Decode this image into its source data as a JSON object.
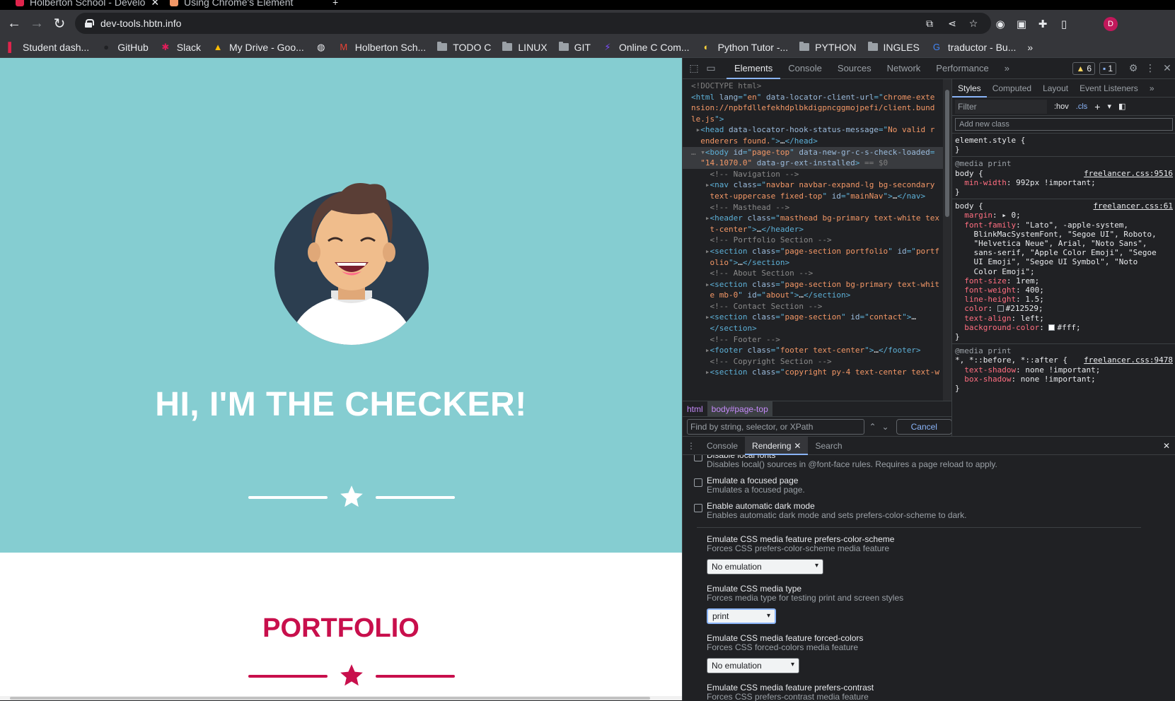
{
  "browser": {
    "tabs": [
      {
        "title": "Holberton School - Develo"
      },
      {
        "title": "Using Chrome's Element"
      }
    ],
    "new_tab": "+",
    "url": "dev-tools.hbtn.info",
    "profile_initial": "D"
  },
  "bookmarks": [
    {
      "label": "Student dash...",
      "icon": "holberton-icon"
    },
    {
      "label": "GitHub",
      "icon": "github-icon"
    },
    {
      "label": "Slack",
      "icon": "slack-icon"
    },
    {
      "label": "My Drive - Goo...",
      "icon": "drive-icon"
    },
    {
      "label": "",
      "icon": "globe-icon"
    },
    {
      "label": "Holberton Sch...",
      "icon": "gmail-icon"
    },
    {
      "label": "TODO C",
      "icon": "folder-icon"
    },
    {
      "label": "LINUX",
      "icon": "folder-icon"
    },
    {
      "label": "GIT",
      "icon": "folder-icon"
    },
    {
      "label": "Online C Com...",
      "icon": "compiler-icon"
    },
    {
      "label": "Python Tutor -...",
      "icon": "python-icon"
    },
    {
      "label": "PYTHON",
      "icon": "folder-icon"
    },
    {
      "label": "INGLES",
      "icon": "folder-icon"
    },
    {
      "label": "traductor - Bu...",
      "icon": "google-icon"
    }
  ],
  "page": {
    "hero_title": "HI, I'M THE CHECKER!",
    "portfolio_title": "PORTFOLIO",
    "colors": {
      "masthead": "#85cdd1",
      "accent": "#c80f4c",
      "avatar_bg": "#2c3e50"
    }
  },
  "devtools": {
    "tabs": [
      "Elements",
      "Console",
      "Sources",
      "Network",
      "Performance"
    ],
    "more": "»",
    "warnings_count": "6",
    "messages_count": "1",
    "dom": [
      {
        "parts": [
          [
            "c-gray",
            "<!DOCTYPE html>"
          ]
        ]
      },
      {
        "parts": [
          [
            "c-tag",
            "<html "
          ],
          [
            "c-attr",
            "lang"
          ],
          [
            "c-tag",
            "=\""
          ],
          [
            "c-val",
            "en"
          ],
          [
            "c-tag",
            "\" "
          ],
          [
            "c-attr",
            "data-locator-client-url"
          ],
          [
            "c-tag",
            "=\""
          ],
          [
            "c-val",
            "chrome-exte"
          ]
        ]
      },
      {
        "parts": [
          [
            "c-val",
            "nsion://npbfdllefekhdplbkdigpncggmojpefi/client.bund"
          ]
        ]
      },
      {
        "parts": [
          [
            "c-val",
            "le.js"
          ],
          [
            "c-tag",
            "\">"
          ]
        ]
      },
      {
        "parts": [
          [
            "c-gray",
            " ▸"
          ],
          [
            "c-tag",
            "<head "
          ],
          [
            "c-attr",
            "data-locator-hook-status-message"
          ],
          [
            "c-tag",
            "=\""
          ],
          [
            "c-val",
            "No valid r"
          ]
        ]
      },
      {
        "parts": [
          [
            "c-val",
            "  enderers found."
          ],
          [
            "c-tag",
            "\">"
          ],
          [
            "c-txt",
            "…"
          ],
          [
            "c-tag",
            "</head>"
          ]
        ]
      },
      {
        "sel": true,
        "parts": [
          [
            "c-gray",
            "… ▾"
          ],
          [
            "c-tag",
            "<body "
          ],
          [
            "c-attr",
            "id"
          ],
          [
            "c-tag",
            "=\""
          ],
          [
            "c-val",
            "page-top"
          ],
          [
            "c-tag",
            "\" "
          ],
          [
            "c-attr",
            "data-new-gr-c-s-check-loaded"
          ],
          [
            "c-tag",
            "="
          ]
        ]
      },
      {
        "sel": true,
        "parts": [
          [
            "c-val",
            "  \"14.1070.0\" "
          ],
          [
            "c-attr",
            "data-gr-ext-installed"
          ],
          [
            "c-tag",
            ">"
          ],
          [
            "c-gray",
            " == $0"
          ]
        ]
      },
      {
        "parts": [
          [
            "c-cm",
            "    <!-- Navigation -->"
          ]
        ]
      },
      {
        "parts": [
          [
            "c-gray",
            "   ▸"
          ],
          [
            "c-tag",
            "<nav "
          ],
          [
            "c-attr",
            "class"
          ],
          [
            "c-tag",
            "=\""
          ],
          [
            "c-val",
            "navbar navbar-expand-lg bg-secondary"
          ]
        ]
      },
      {
        "parts": [
          [
            "c-val",
            "    text-uppercase fixed-top"
          ],
          [
            "c-tag",
            "\" "
          ],
          [
            "c-attr",
            "id"
          ],
          [
            "c-tag",
            "=\""
          ],
          [
            "c-val",
            "mainNav"
          ],
          [
            "c-tag",
            "\">"
          ],
          [
            "c-txt",
            "…"
          ],
          [
            "c-tag",
            "</nav>"
          ]
        ]
      },
      {
        "parts": [
          [
            "c-cm",
            "    <!-- Masthead -->"
          ]
        ]
      },
      {
        "parts": [
          [
            "c-gray",
            "   ▸"
          ],
          [
            "c-tag",
            "<header "
          ],
          [
            "c-attr",
            "class"
          ],
          [
            "c-tag",
            "=\""
          ],
          [
            "c-val",
            "masthead bg-primary text-white tex"
          ]
        ]
      },
      {
        "parts": [
          [
            "c-val",
            "    t-center"
          ],
          [
            "c-tag",
            "\">"
          ],
          [
            "c-txt",
            "…"
          ],
          [
            "c-tag",
            "</header>"
          ]
        ]
      },
      {
        "parts": [
          [
            "c-cm",
            "    <!-- Portfolio Section -->"
          ]
        ]
      },
      {
        "parts": [
          [
            "c-gray",
            "   ▸"
          ],
          [
            "c-tag",
            "<section "
          ],
          [
            "c-attr",
            "class"
          ],
          [
            "c-tag",
            "=\""
          ],
          [
            "c-val",
            "page-section portfolio"
          ],
          [
            "c-tag",
            "\" "
          ],
          [
            "c-attr",
            "id"
          ],
          [
            "c-tag",
            "=\""
          ],
          [
            "c-val",
            "portf"
          ]
        ]
      },
      {
        "parts": [
          [
            "c-val",
            "    olio"
          ],
          [
            "c-tag",
            "\">"
          ],
          [
            "c-txt",
            "…"
          ],
          [
            "c-tag",
            "</section>"
          ]
        ]
      },
      {
        "parts": [
          [
            "c-cm",
            "    <!-- About Section -->"
          ]
        ]
      },
      {
        "parts": [
          [
            "c-gray",
            "   ▸"
          ],
          [
            "c-tag",
            "<section "
          ],
          [
            "c-attr",
            "class"
          ],
          [
            "c-tag",
            "=\""
          ],
          [
            "c-val",
            "page-section bg-primary text-whit"
          ]
        ]
      },
      {
        "parts": [
          [
            "c-val",
            "    e mb-0"
          ],
          [
            "c-tag",
            "\" "
          ],
          [
            "c-attr",
            "id"
          ],
          [
            "c-tag",
            "=\""
          ],
          [
            "c-val",
            "about"
          ],
          [
            "c-tag",
            "\">"
          ],
          [
            "c-txt",
            "…"
          ],
          [
            "c-tag",
            "</section>"
          ]
        ]
      },
      {
        "parts": [
          [
            "c-cm",
            "    <!-- Contact Section -->"
          ]
        ]
      },
      {
        "parts": [
          [
            "c-gray",
            "   ▸"
          ],
          [
            "c-tag",
            "<section "
          ],
          [
            "c-attr",
            "class"
          ],
          [
            "c-tag",
            "=\""
          ],
          [
            "c-val",
            "page-section"
          ],
          [
            "c-tag",
            "\" "
          ],
          [
            "c-attr",
            "id"
          ],
          [
            "c-tag",
            "=\""
          ],
          [
            "c-val",
            "contact"
          ],
          [
            "c-tag",
            "\">"
          ],
          [
            "c-txt",
            "…"
          ]
        ]
      },
      {
        "parts": [
          [
            "c-tag",
            "    </section>"
          ]
        ]
      },
      {
        "parts": [
          [
            "c-cm",
            "    <!-- Footer -->"
          ]
        ]
      },
      {
        "parts": [
          [
            "c-gray",
            "   ▸"
          ],
          [
            "c-tag",
            "<footer "
          ],
          [
            "c-attr",
            "class"
          ],
          [
            "c-tag",
            "=\""
          ],
          [
            "c-val",
            "footer text-center"
          ],
          [
            "c-tag",
            "\">"
          ],
          [
            "c-txt",
            "…"
          ],
          [
            "c-tag",
            "</footer>"
          ]
        ]
      },
      {
        "parts": [
          [
            "c-cm",
            "    <!-- Copyright Section -->"
          ]
        ]
      },
      {
        "parts": [
          [
            "c-gray",
            "   ▸"
          ],
          [
            "c-tag",
            "<section "
          ],
          [
            "c-attr",
            "class"
          ],
          [
            "c-tag",
            "=\""
          ],
          [
            "c-val",
            "copyright py-4 text-center text-w"
          ]
        ]
      }
    ],
    "breadcrumbs": [
      "html",
      "body#page-top"
    ],
    "find_placeholder": "Find by string, selector, or XPath",
    "find_cancel": "Cancel",
    "styles_tabs": [
      "Styles",
      "Computed",
      "Layout",
      "Event Listeners"
    ],
    "styles_more": "»",
    "filter_placeholder": "Filter",
    "hov": ":hov",
    "cls": ".cls",
    "add_class": "Add new class",
    "rules": [
      {
        "media": "",
        "selector": "element.style {",
        "source": "",
        "props": [],
        "close": "}"
      },
      {
        "media": "@media print",
        "selector": "body {",
        "source": "freelancer.css:9516",
        "props": [
          [
            "min-width",
            "992px !important;"
          ]
        ],
        "close": "}"
      },
      {
        "media": "",
        "selector": "body {",
        "source": "freelancer.css:61",
        "props": [
          [
            "margin",
            "▸ 0;"
          ],
          [
            "font-family",
            "\"Lato\", -apple-system,"
          ],
          [
            "",
            "    BlinkMacSystemFont, \"Segoe UI\", Roboto,"
          ],
          [
            "",
            "    \"Helvetica Neue\", Arial, \"Noto Sans\","
          ],
          [
            "",
            "    sans-serif, \"Apple Color Emoji\", \"Segoe"
          ],
          [
            "",
            "    UI Emoji\", \"Segoe UI Symbol\", \"Noto"
          ],
          [
            "",
            "    Color Emoji\";"
          ],
          [
            "font-size",
            "1rem;"
          ],
          [
            "font-weight",
            "400;"
          ],
          [
            "line-height",
            "1.5;"
          ],
          [
            "color",
            "#212529;"
          ],
          [
            "text-align",
            "left;"
          ],
          [
            "background-color",
            "#fff;"
          ]
        ],
        "close": "}"
      },
      {
        "media": "@media print",
        "selector": "*, *::before, *::after {",
        "source": "freelancer.css:9478",
        "props": [
          [
            "text-shadow",
            "none !important;"
          ],
          [
            "box-shadow",
            "none !important;"
          ]
        ],
        "close": "}"
      }
    ],
    "drawer_tabs": [
      "Console",
      "Rendering",
      "Search"
    ],
    "rendering": {
      "checkboxes": [
        {
          "title": "Disable local fonts",
          "desc": "Disables local() sources in @font-face rules. Requires a page reload to apply."
        },
        {
          "title": "Emulate a focused page",
          "desc": "Emulates a focused page."
        },
        {
          "title": "Enable automatic dark mode",
          "desc": "Enables automatic dark mode and sets prefers-color-scheme to dark."
        }
      ],
      "selects": [
        {
          "title": "Emulate CSS media feature prefers-color-scheme",
          "desc": "Forces CSS prefers-color-scheme media feature",
          "value": "No emulation"
        },
        {
          "title": "Emulate CSS media type",
          "desc": "Forces media type for testing print and screen styles",
          "value": "print"
        },
        {
          "title": "Emulate CSS media feature forced-colors",
          "desc": "Forces CSS forced-colors media feature",
          "value": "No emulation"
        },
        {
          "title": "Emulate CSS media feature prefers-contrast",
          "desc": "Forces CSS prefers-contrast media feature",
          "value": ""
        }
      ]
    }
  }
}
